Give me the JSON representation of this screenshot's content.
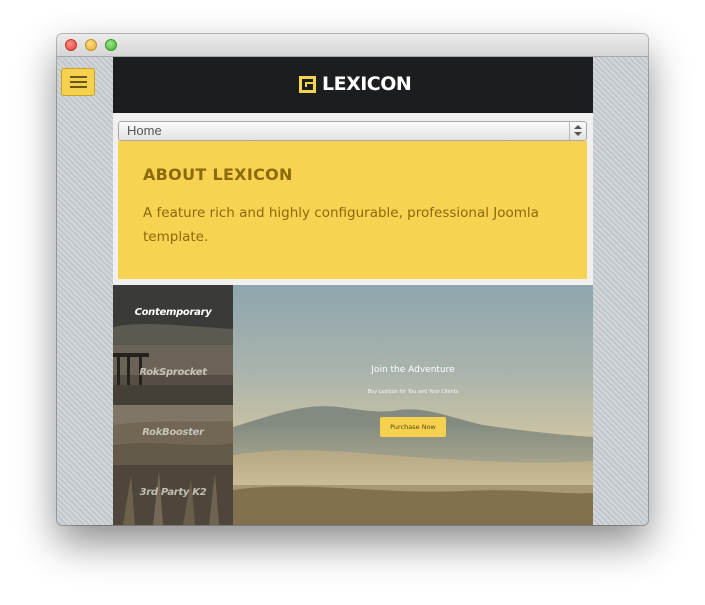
{
  "brand": {
    "name": "LEXICON",
    "accent": "#f6d351",
    "dark": "#1c1d1f"
  },
  "nav_select": {
    "value": "Home"
  },
  "about": {
    "title": "ABOUT LEXICON",
    "text": "A feature rich and highly configurable, professional Joomla template."
  },
  "showcase": {
    "tabs": [
      {
        "label": "Contemporary",
        "active": true
      },
      {
        "label": "RokSprocket",
        "active": false
      },
      {
        "label": "RokBooster",
        "active": false
      },
      {
        "label": "3rd Party K2",
        "active": false
      }
    ],
    "slide": {
      "title": "Join the Adventure",
      "subtitle": "Buy Lexicon for You and Your Clients",
      "button": "Purchase Now"
    }
  },
  "icons": [
    "hamburger-menu-icon",
    "lexicon-logo-icon",
    "select-arrows-icon"
  ]
}
